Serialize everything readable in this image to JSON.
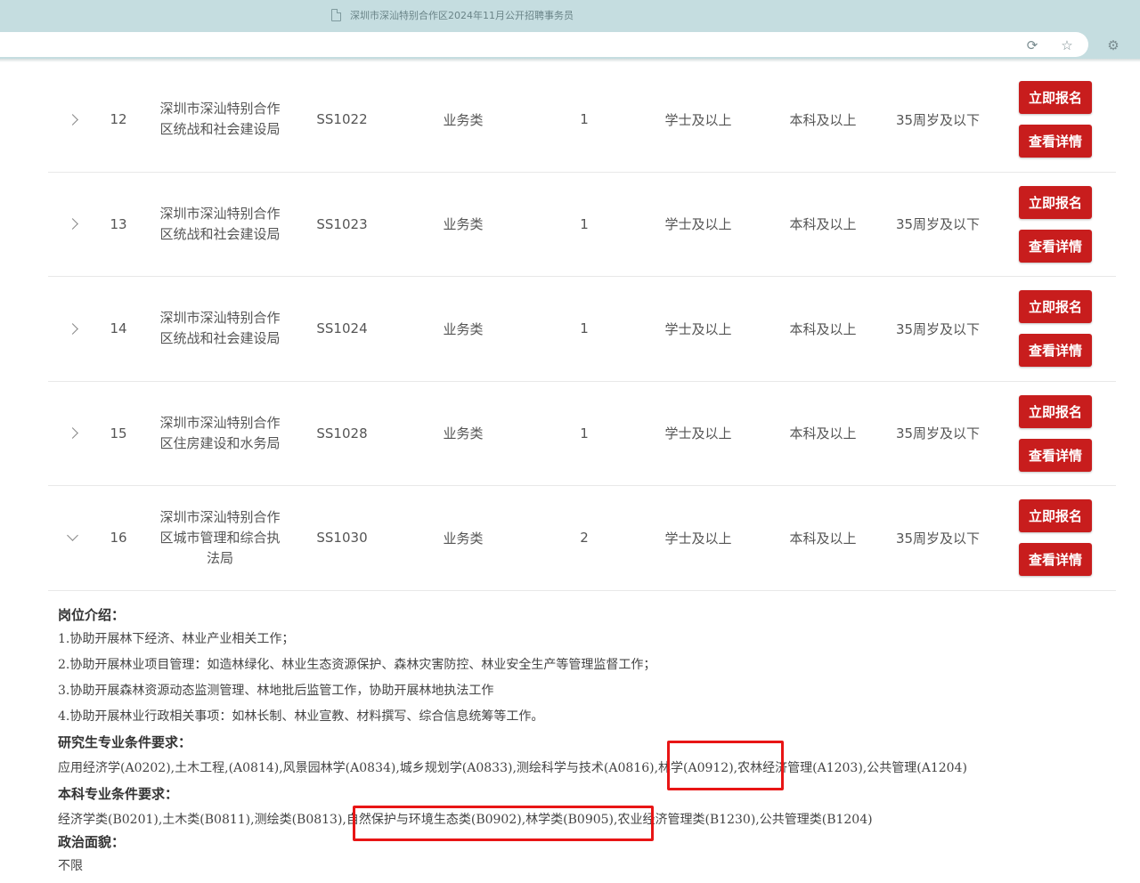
{
  "browser": {
    "tab_title": "深圳市深汕特别合作区2024年11月公开招聘事务员",
    "icons": [
      "doc-icon",
      "refresh-icon",
      "star-icon",
      "extensions-icon"
    ]
  },
  "rows": [
    {
      "num": "12",
      "dept": "深圳市深汕特别合作区统战和社会建设局",
      "code": "SS1022",
      "type": "业务类",
      "count": "1",
      "degree": "学士及以上",
      "education": "本科及以上",
      "age": "35周岁及以下",
      "apply": "立即报名",
      "detail": "查看详情",
      "expanded": false
    },
    {
      "num": "13",
      "dept": "深圳市深汕特别合作区统战和社会建设局",
      "code": "SS1023",
      "type": "业务类",
      "count": "1",
      "degree": "学士及以上",
      "education": "本科及以上",
      "age": "35周岁及以下",
      "apply": "立即报名",
      "detail": "查看详情",
      "expanded": false
    },
    {
      "num": "14",
      "dept": "深圳市深汕特别合作区统战和社会建设局",
      "code": "SS1024",
      "type": "业务类",
      "count": "1",
      "degree": "学士及以上",
      "education": "本科及以上",
      "age": "35周岁及以下",
      "apply": "立即报名",
      "detail": "查看详情",
      "expanded": false
    },
    {
      "num": "15",
      "dept": "深圳市深汕特别合作区住房建设和水务局",
      "code": "SS1028",
      "type": "业务类",
      "count": "1",
      "degree": "学士及以上",
      "education": "本科及以上",
      "age": "35周岁及以下",
      "apply": "立即报名",
      "detail": "查看详情",
      "expanded": false
    },
    {
      "num": "16",
      "dept": "深圳市深汕特别合作区城市管理和综合执法局",
      "code": "SS1030",
      "type": "业务类",
      "count": "2",
      "degree": "学士及以上",
      "education": "本科及以上",
      "age": "35周岁及以下",
      "apply": "立即报名",
      "detail": "查看详情",
      "expanded": true
    }
  ],
  "details": {
    "intro_heading": "岗位介绍：",
    "intro_lines": [
      "1.协助开展林下经济、林业产业相关工作；",
      "2.协助开展林业项目管理：如造林绿化、林业生态资源保护、森林灾害防控、林业安全生产等管理监督工作；",
      "3.协助开展森林资源动态监测管理、林地批后监管工作，协助开展林地执法工作",
      "4.协助开展林业行政相关事项：如林长制、林业宣教、材料撰写、综合信息统筹等工作。"
    ],
    "grad_heading": "研究生专业条件要求：",
    "grad_text": "应用经济学(A0202),土木工程,(A0814),风景园林学(A0834),城乡规划学(A0833),测绘科学与技术(A0816),林学(A0912),农林经济管理(A1203),公共管理(A1204)",
    "undergrad_heading": "本科专业条件要求：",
    "undergrad_text": "经济学类(B0201),土木类(B0811),测绘类(B0813),自然保护与环境生态类(B0902),林学类(B0905),农业经济管理类(B1230),公共管理类(B1204)",
    "politics_heading": "政治面貌：",
    "politics_text": "不限"
  },
  "colors": {
    "button": "#c81d1d",
    "highlight_box": "#e81515",
    "chrome": "#c5dde0"
  }
}
